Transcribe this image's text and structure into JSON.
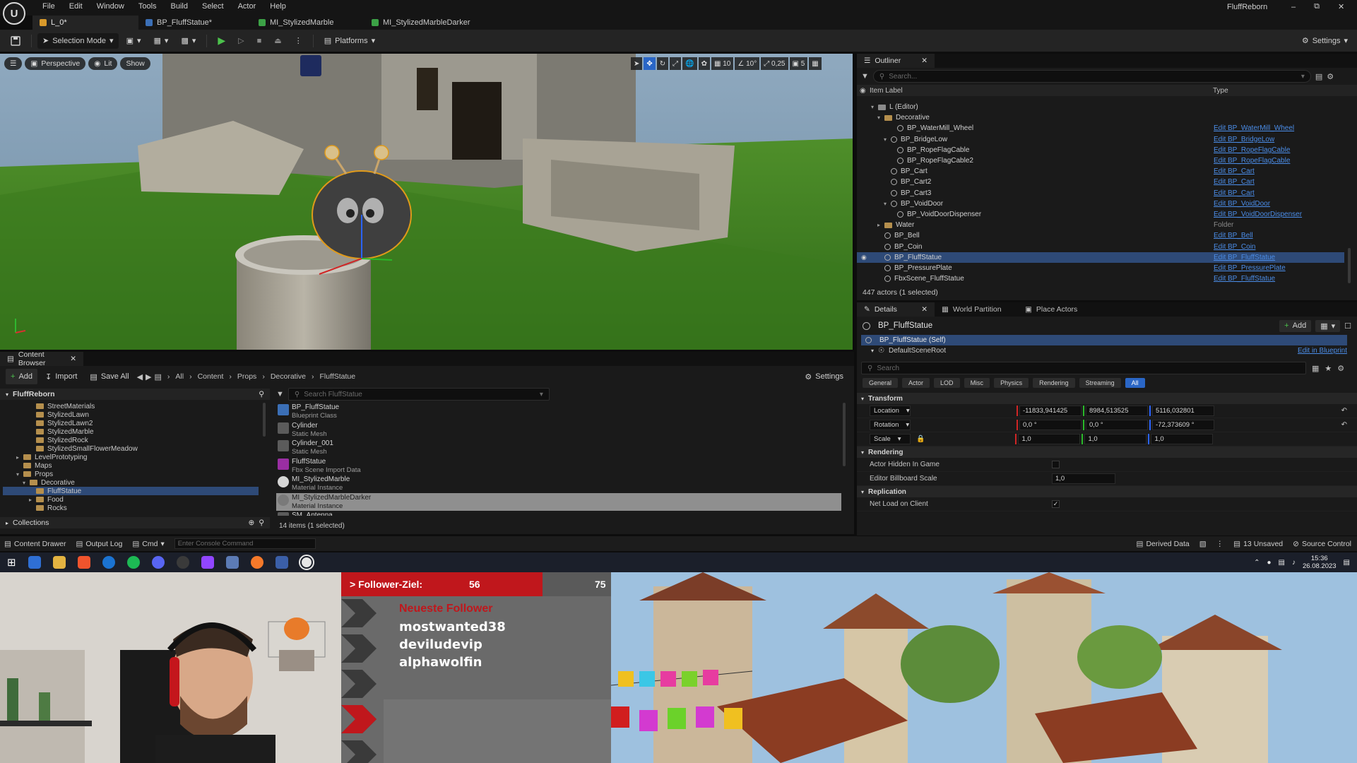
{
  "menu": [
    "File",
    "Edit",
    "Window",
    "Tools",
    "Build",
    "Select",
    "Actor",
    "Help"
  ],
  "project_name": "FluffReborn",
  "window_controls": [
    "minimize-icon",
    "restore-icon",
    "close-icon"
  ],
  "doc_tabs": [
    {
      "label": "L_0*",
      "active": true
    },
    {
      "label": "BP_FluffStatue*",
      "active": false
    },
    {
      "label": "MI_StylizedMarble",
      "active": false
    },
    {
      "label": "MI_StylizedMarbleDarker",
      "active": false
    }
  ],
  "toolbar": {
    "mode_label": "Selection Mode",
    "platforms_label": "Platforms",
    "settings_label": "Settings"
  },
  "viewport": {
    "view_mode": "Perspective",
    "lighting": "Lit",
    "show_label": "Show",
    "grid_snap": "10",
    "rot_snap": "10°",
    "scale_snap": "0,25",
    "cam_speed": "5"
  },
  "outliner": {
    "tab_label": "Outliner",
    "search_placeholder": "Search...",
    "col_label": "Item Label",
    "col_type": "Type",
    "rows": [
      {
        "label": "L (Editor)",
        "type": "",
        "indent": 0,
        "kind": "level"
      },
      {
        "label": "Decorative",
        "type": "",
        "indent": 1,
        "kind": "folder"
      },
      {
        "label": "BP_WaterMill_Wheel",
        "type": "Edit BP_WaterMill_Wheel",
        "indent": 3,
        "kind": "actor"
      },
      {
        "label": "BP_BridgeLow",
        "type": "Edit BP_BridgeLow",
        "indent": 2,
        "kind": "actor"
      },
      {
        "label": "BP_RopeFlagCable",
        "type": "Edit BP_RopeFlagCable",
        "indent": 3,
        "kind": "actor"
      },
      {
        "label": "BP_RopeFlagCable2",
        "type": "Edit BP_RopeFlagCable",
        "indent": 3,
        "kind": "actor"
      },
      {
        "label": "BP_Cart",
        "type": "Edit BP_Cart",
        "indent": 2,
        "kind": "actor"
      },
      {
        "label": "BP_Cart2",
        "type": "Edit BP_Cart",
        "indent": 2,
        "kind": "actor"
      },
      {
        "label": "BP_Cart3",
        "type": "Edit BP_Cart",
        "indent": 2,
        "kind": "actor"
      },
      {
        "label": "BP_VoidDoor",
        "type": "Edit BP_VoidDoor",
        "indent": 2,
        "kind": "actor"
      },
      {
        "label": "BP_VoidDoorDispenser",
        "type": "Edit BP_VoidDoorDispenser",
        "indent": 3,
        "kind": "actor"
      },
      {
        "label": "Water",
        "type": "Folder",
        "indent": 1,
        "kind": "folder"
      },
      {
        "label": "BP_Bell",
        "type": "Edit BP_Bell",
        "indent": 1,
        "kind": "actor"
      },
      {
        "label": "BP_Coin",
        "type": "Edit BP_Coin",
        "indent": 1,
        "kind": "actor"
      },
      {
        "label": "BP_FluffStatue",
        "type": "Edit BP_FluffStatue",
        "indent": 1,
        "kind": "actor",
        "selected": true
      },
      {
        "label": "BP_PressurePlate",
        "type": "Edit BP_PressurePlate",
        "indent": 1,
        "kind": "actor"
      },
      {
        "label": "FbxScene_FluffStatue",
        "type": "Edit BP_FluffStatue",
        "indent": 1,
        "kind": "actor"
      }
    ],
    "footer": "447 actors (1 selected)"
  },
  "details": {
    "tabs": [
      "Details",
      "World Partition",
      "Place Actors"
    ],
    "actor_name": "BP_FluffStatue",
    "add_label": "Add",
    "self_label": "BP_FluffStatue (Self)",
    "root_label": "DefaultSceneRoot",
    "edit_bp_label": "Edit in Blueprint",
    "search_placeholder": "Search",
    "filters": [
      "General",
      "Actor",
      "LOD",
      "Misc",
      "Physics",
      "Rendering",
      "Streaming",
      "All"
    ],
    "transform_label": "Transform",
    "location_label": "Location",
    "location": [
      "-11833,941425",
      "8984,513525",
      "5116,032801"
    ],
    "rotation_label": "Rotation",
    "rotation": [
      "0,0 °",
      "0,0 °",
      "-72,373609 °"
    ],
    "scale_label": "Scale",
    "scale": [
      "1,0",
      "1,0",
      "1,0"
    ],
    "rendering_label": "Rendering",
    "hidden_label": "Actor Hidden In Game",
    "billboard_label": "Editor Billboard Scale",
    "billboard_value": "1,0",
    "replication_label": "Replication",
    "netload_label": "Net Load on Client"
  },
  "content_browser": {
    "tab_label": "Content Browser",
    "add_label": "Add",
    "import_label": "Import",
    "saveall_label": "Save All",
    "breadcrumb": [
      "All",
      "Content",
      "Props",
      "Decorative",
      "FluffStatue"
    ],
    "settings_label": "Settings",
    "root_label": "FluffReborn",
    "folders": [
      {
        "label": "StreetMaterials",
        "indent": 3
      },
      {
        "label": "StylizedLawn",
        "indent": 3
      },
      {
        "label": "StylizedLawn2",
        "indent": 3
      },
      {
        "label": "StylizedMarble",
        "indent": 3
      },
      {
        "label": "StylizedRock",
        "indent": 3
      },
      {
        "label": "StylizedSmallFlowerMeadow",
        "indent": 3
      },
      {
        "label": "LevelPrototyping",
        "indent": 1
      },
      {
        "label": "Maps",
        "indent": 1
      },
      {
        "label": "Props",
        "indent": 1
      },
      {
        "label": "Decorative",
        "indent": 2
      },
      {
        "label": "FluffStatue",
        "indent": 3,
        "selected": true
      },
      {
        "label": "Food",
        "indent": 3
      },
      {
        "label": "Rocks",
        "indent": 3
      }
    ],
    "collections_label": "Collections",
    "search_placeholder": "Search FluffStatue",
    "assets": [
      {
        "name": "BP_FluffStatue",
        "type": "Blueprint Class",
        "color": "#3b6fb6"
      },
      {
        "name": "Cylinder",
        "type": "Static Mesh",
        "color": "#5b5b5b"
      },
      {
        "name": "Cylinder_001",
        "type": "Static Mesh",
        "color": "#5b5b5b"
      },
      {
        "name": "FluffStatue",
        "type": "Fbx Scene Import Data",
        "color": "#9a2ea3"
      },
      {
        "name": "MI_StylizedMarble",
        "type": "Material Instance",
        "color": "#d5d5d5"
      },
      {
        "name": "MI_StylizedMarbleDarker",
        "type": "Material Instance",
        "color": "#7a7a7a",
        "selected": true
      },
      {
        "name": "SM_Antenna",
        "type": "",
        "color": "#5b5b5b"
      }
    ],
    "footer": "14 items (1 selected)"
  },
  "statusbar": {
    "content_drawer": "Content Drawer",
    "output_log": "Output Log",
    "cmd": "Cmd",
    "console_placeholder": "Enter Console Command",
    "derived_data": "Derived Data",
    "unsaved": "13 Unsaved",
    "source_control": "Source Control"
  },
  "taskbar": {
    "time": "15:36",
    "date": "26.08.2023"
  },
  "overlay": {
    "goal_label": "> Follower-Ziel:",
    "goal_current": "56",
    "goal_target": "75",
    "goal_progress": 0.7467,
    "newest_label": "Neueste Follower",
    "followers": [
      "mostwanted38",
      "deviludevip",
      "alphawolfin"
    ]
  },
  "colors": {
    "accent": "#2a66c6",
    "selection": "#2e4a77",
    "link": "#4b8de8",
    "goal_red": "#c0171c"
  }
}
